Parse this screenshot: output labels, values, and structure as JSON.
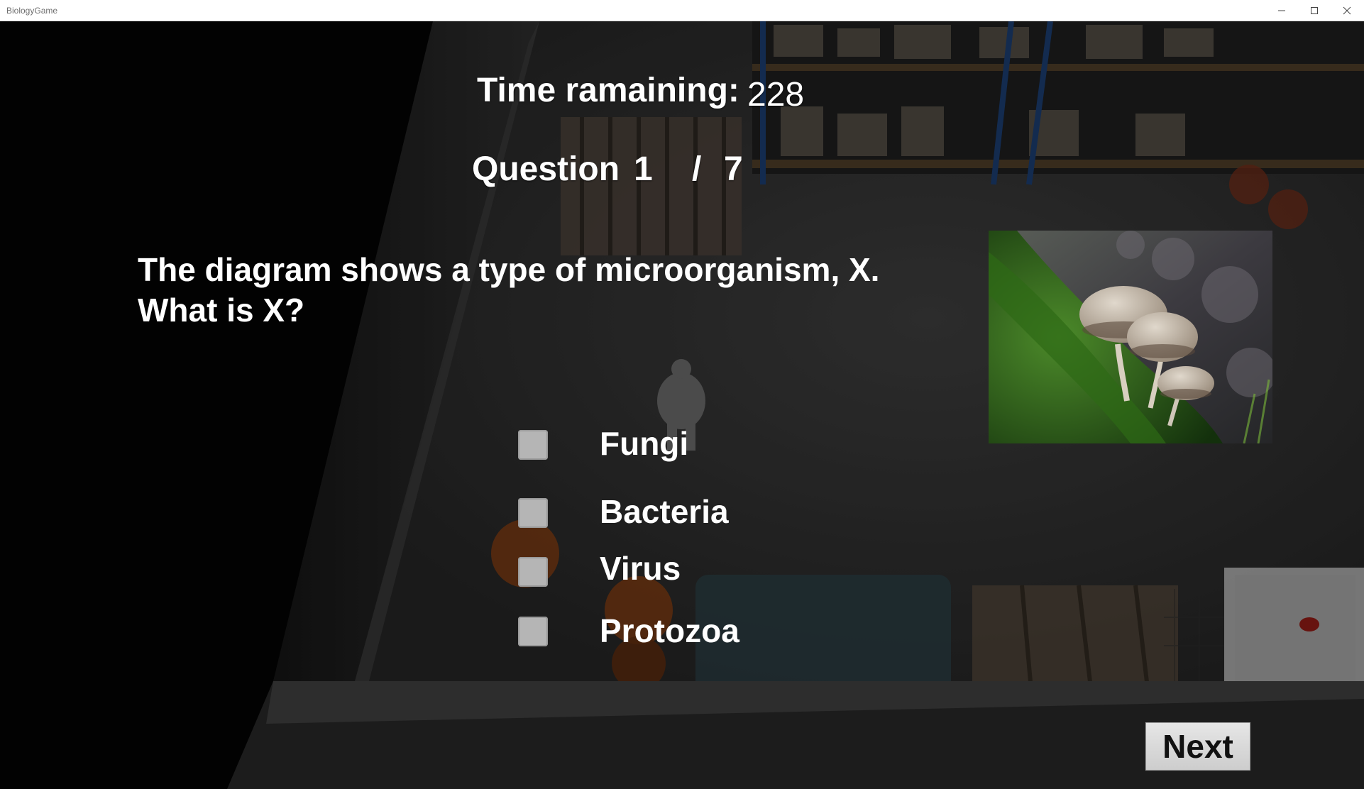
{
  "window": {
    "title": "BiologyGame"
  },
  "hud": {
    "time_label": "Time ramaining:",
    "time_value": "228",
    "question_label": "Question",
    "question_number": "1",
    "question_separator": "/",
    "question_total": "7"
  },
  "question": {
    "text": "The diagram shows a type of microorganism, X. What is X?"
  },
  "options": [
    {
      "label": "Fungi",
      "checked": false
    },
    {
      "label": "Bacteria",
      "checked": false
    },
    {
      "label": "Virus",
      "checked": false
    },
    {
      "label": "Protozoa",
      "checked": false
    }
  ],
  "buttons": {
    "next_label": "Next"
  },
  "icons": {
    "minimize": "minimize-icon",
    "maximize": "maximize-icon",
    "close": "close-icon"
  }
}
